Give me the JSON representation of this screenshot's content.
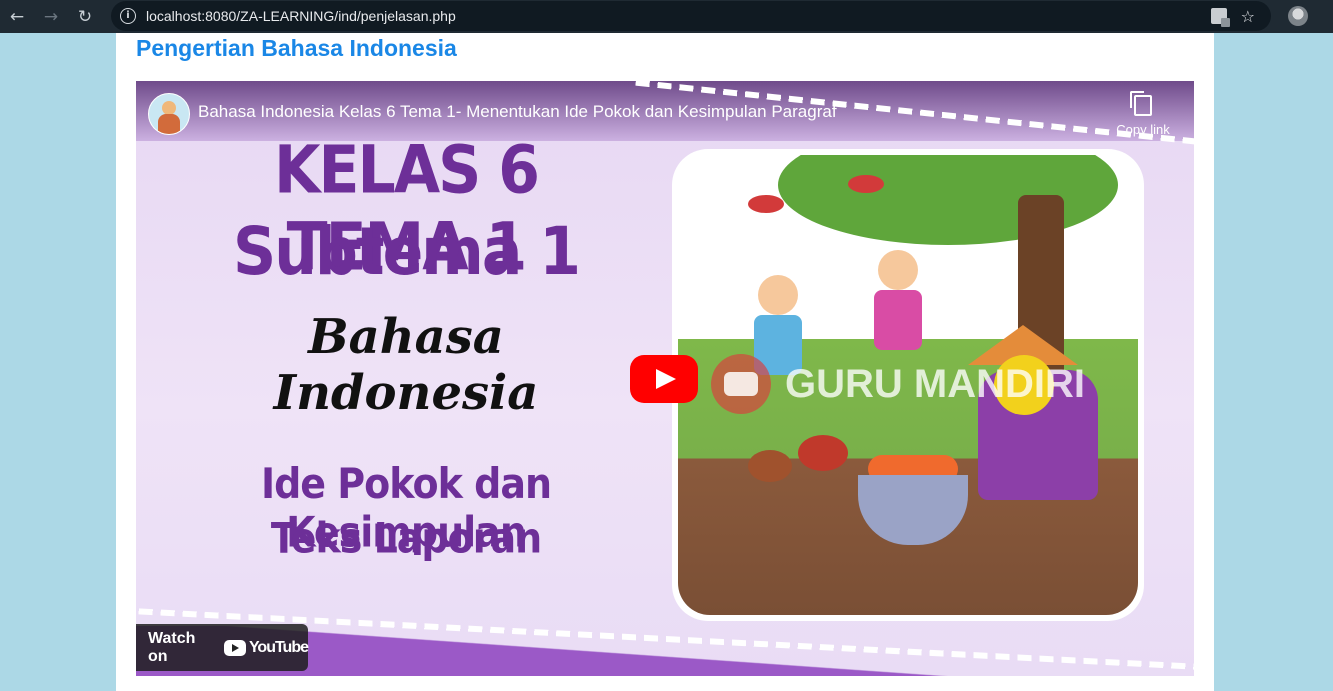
{
  "browser": {
    "url": "localhost:8080/ZA-LEARNING/ind/penjelasan.php",
    "icons": [
      "back-icon",
      "forward-icon",
      "reload-icon",
      "info-icon",
      "translate-icon",
      "bookmark-star-icon",
      "profile-avatar"
    ]
  },
  "page": {
    "title": "Pengertian Bahasa Indonesia",
    "title_color": "#1a87e6",
    "background": "#acd8e6"
  },
  "video": {
    "title": "Bahasa Indonesia Kelas 6 Tema 1- Menentukan Ide Pokok dan Kesimpulan Paragraf",
    "copy_link_label": "Copy link",
    "watch_on_label": "Watch on",
    "youtube_label": "YouTube",
    "thumbnail": {
      "line1": "KELAS 6 TEMA 1",
      "line2": "Subtema 1",
      "line3": "Bahasa Indonesia",
      "line4": "Ide Pokok dan Kesimpulan",
      "line5": "Teks Laporan",
      "watermark": "GURU MANDIRI",
      "accent_color": "#6d2f98"
    }
  }
}
